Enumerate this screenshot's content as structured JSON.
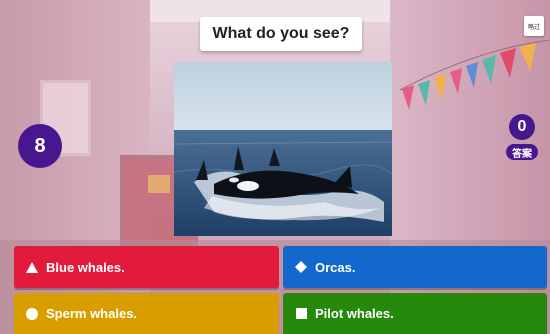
{
  "question": {
    "title": "What do you see?"
  },
  "corner_button": {
    "label": "略过"
  },
  "timer": {
    "value": "8"
  },
  "answers_count": {
    "value": "0",
    "label": "答案"
  },
  "image": {
    "subject": "orcas-swimming-photo"
  },
  "answers": [
    {
      "label": "Blue whales.",
      "shape": "triangle-icon",
      "color": "#e21b3c"
    },
    {
      "label": "Orcas.",
      "shape": "diamond-icon",
      "color": "#1368ce"
    },
    {
      "label": "Sperm whales.",
      "shape": "circle-icon",
      "color": "#d89e00"
    },
    {
      "label": "Pilot whales.",
      "shape": "square-icon",
      "color": "#26890c"
    }
  ]
}
